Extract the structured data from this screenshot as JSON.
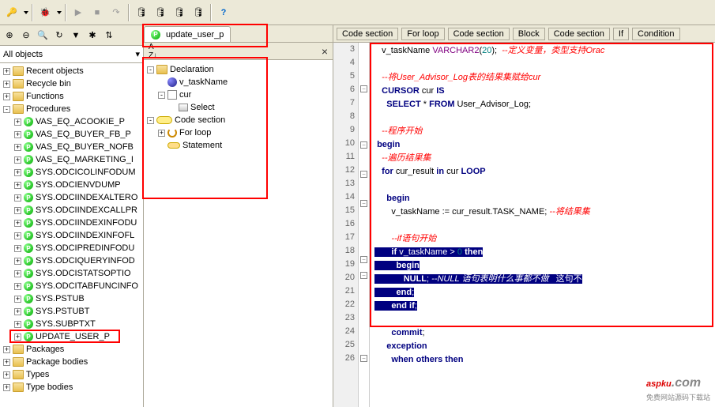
{
  "toolbar_icons": [
    "key",
    "bug",
    "play",
    "stop",
    "step",
    "db1",
    "db2",
    "db3",
    "db4",
    "help"
  ],
  "filter_label": "All objects",
  "object_tree": [
    {
      "label": "Recent objects",
      "icon": "folder",
      "expand": "+",
      "level": 0
    },
    {
      "label": "Recycle bin",
      "icon": "folder",
      "expand": "+",
      "level": 0
    },
    {
      "label": "Functions",
      "icon": "folder",
      "expand": "+",
      "level": 0
    },
    {
      "label": "Procedures",
      "icon": "folder",
      "expand": "-",
      "level": 0
    },
    {
      "label": "VAS_EQ_ACOOKIE_P",
      "icon": "proc",
      "expand": "+",
      "level": 1
    },
    {
      "label": "VAS_EQ_BUYER_FB_P",
      "icon": "proc",
      "expand": "+",
      "level": 1
    },
    {
      "label": "VAS_EQ_BUYER_NOFB",
      "icon": "proc",
      "expand": "+",
      "level": 1
    },
    {
      "label": "VAS_EQ_MARKETING_I",
      "icon": "proc",
      "expand": "+",
      "level": 1
    },
    {
      "label": "SYS.ODCICOLINFODUM",
      "icon": "proc",
      "expand": "+",
      "level": 1
    },
    {
      "label": "SYS.ODCIENVDUMP",
      "icon": "proc",
      "expand": "+",
      "level": 1
    },
    {
      "label": "SYS.ODCIINDEXALTERO",
      "icon": "proc",
      "expand": "+",
      "level": 1
    },
    {
      "label": "SYS.ODCIINDEXCALLPR",
      "icon": "proc",
      "expand": "+",
      "level": 1
    },
    {
      "label": "SYS.ODCIINDEXINFODU",
      "icon": "proc",
      "expand": "+",
      "level": 1
    },
    {
      "label": "SYS.ODCIINDEXINFOFL",
      "icon": "proc",
      "expand": "+",
      "level": 1
    },
    {
      "label": "SYS.ODCIPREDINFODU",
      "icon": "proc",
      "expand": "+",
      "level": 1
    },
    {
      "label": "SYS.ODCIQUERYINFOD",
      "icon": "proc",
      "expand": "+",
      "level": 1
    },
    {
      "label": "SYS.ODCISTATSOPTIO",
      "icon": "proc",
      "expand": "+",
      "level": 1
    },
    {
      "label": "SYS.ODCITABFUNCINFO",
      "icon": "proc",
      "expand": "+",
      "level": 1
    },
    {
      "label": "SYS.PSTUB",
      "icon": "proc",
      "expand": "+",
      "level": 1
    },
    {
      "label": "SYS.PSTUBT",
      "icon": "proc",
      "expand": "+",
      "level": 1
    },
    {
      "label": "SYS.SUBPTXT",
      "icon": "proc",
      "expand": "+",
      "level": 1
    },
    {
      "label": "UPDATE_USER_P",
      "icon": "proc",
      "expand": "+",
      "level": 1,
      "hl": true
    },
    {
      "label": "Packages",
      "icon": "folder",
      "expand": "+",
      "level": 0
    },
    {
      "label": "Package bodies",
      "icon": "folder",
      "expand": "+",
      "level": 0
    },
    {
      "label": "Types",
      "icon": "folder",
      "expand": "+",
      "level": 0
    },
    {
      "label": "Type bodies",
      "icon": "folder",
      "expand": "+",
      "level": 0
    }
  ],
  "tab_title": "update_user_p",
  "sort_label": "A↓Z",
  "outline": [
    {
      "label": "Declaration",
      "icon": "folder",
      "expand": "-",
      "level": 0
    },
    {
      "label": "v_taskName",
      "icon": "var",
      "level": 1
    },
    {
      "label": "cur",
      "icon": "cursor",
      "expand": "-",
      "level": 1
    },
    {
      "label": "Select",
      "icon": "select",
      "level": 2
    },
    {
      "label": "Code section",
      "icon": "code",
      "expand": "-",
      "level": 0
    },
    {
      "label": "For loop",
      "icon": "loop",
      "expand": "+",
      "level": 1
    },
    {
      "label": "Statement",
      "icon": "stmt",
      "level": 1
    }
  ],
  "breadcrumbs": [
    "Code section",
    "For loop",
    "Code section",
    "Block",
    "Code section",
    "If",
    "Condition"
  ],
  "code_lines": [
    {
      "n": 3,
      "f": "",
      "html": "   v_taskName <span class='fn'>VARCHAR2</span>(<span class='str'>20</span>);  <span class='cm'>--定义变量，类型支持Orac</span>"
    },
    {
      "n": 4,
      "f": "",
      "html": ""
    },
    {
      "n": 5,
      "f": "",
      "html": "   <span class='cm'>--将User_Advisor_Log表的结果集赋给cur</span>"
    },
    {
      "n": 6,
      "f": "m",
      "html": "   <span class='kw'>CURSOR</span> cur <span class='kw'>IS</span>"
    },
    {
      "n": 7,
      "f": "",
      "html": "     <span class='kw'>SELECT</span> * <span class='kw'>FROM</span> User_Advisor_Log;"
    },
    {
      "n": 8,
      "f": "",
      "html": ""
    },
    {
      "n": 9,
      "f": "",
      "html": "   <span class='cm'>--程序开始</span>"
    },
    {
      "n": 10,
      "f": "m",
      "html": " <span class='kw'>begin</span>"
    },
    {
      "n": 11,
      "f": "",
      "html": "   <span class='cm'>--遍历结果集</span>"
    },
    {
      "n": 12,
      "f": "m",
      "html": "   <span class='kw'>for</span> cur_result <span class='kw'>in</span> cur <span class='kw'>LOOP</span>"
    },
    {
      "n": 13,
      "f": "",
      "html": ""
    },
    {
      "n": 14,
      "f": "m",
      "html": "     <span class='kw'>begin</span>"
    },
    {
      "n": 15,
      "f": "",
      "html": "       v_taskName := cur_result.TASK_NAME; <span class='cm'>--将结果集</span>"
    },
    {
      "n": 16,
      "f": "",
      "html": ""
    },
    {
      "n": 17,
      "f": "",
      "html": "       <span class='cm'>--if语句开始</span>"
    },
    {
      "n": 18,
      "f": "m",
      "html": "<span class='sel'>       <span class='kw'>if</span> v_taskName &gt; <span class='str'>0</span> <span class='kw'>then</span></span>"
    },
    {
      "n": 19,
      "f": "m",
      "html": "<span class='sel'>         <span class='kw'>begin</span></span>"
    },
    {
      "n": 20,
      "f": "",
      "html": "<span class='sel'>            <span class='kw'>NULL</span>; <span class='cm'>--NULL 语句表明什么事都不做</span>   这句不</span>"
    },
    {
      "n": 21,
      "f": "",
      "html": "<span class='sel'>         <span class='kw'>end</span>;</span>"
    },
    {
      "n": 22,
      "f": "",
      "html": "<span class='sel'>       <span class='kw'>end</span> <span class='kw'>if</span>;</span>"
    },
    {
      "n": 23,
      "f": "",
      "html": ""
    },
    {
      "n": 24,
      "f": "",
      "html": "       <span class='kw'>commit</span>;"
    },
    {
      "n": 25,
      "f": "m",
      "html": "     <span class='kw'>exception</span>"
    },
    {
      "n": 26,
      "f": "",
      "html": "       <span class='kw'>when</span> <span class='kw'>others</span> <span class='kw'>then</span>"
    }
  ],
  "watermark": {
    "main": "aspku",
    "suffix": ".com",
    "sub": "免费网站源码下载站"
  }
}
